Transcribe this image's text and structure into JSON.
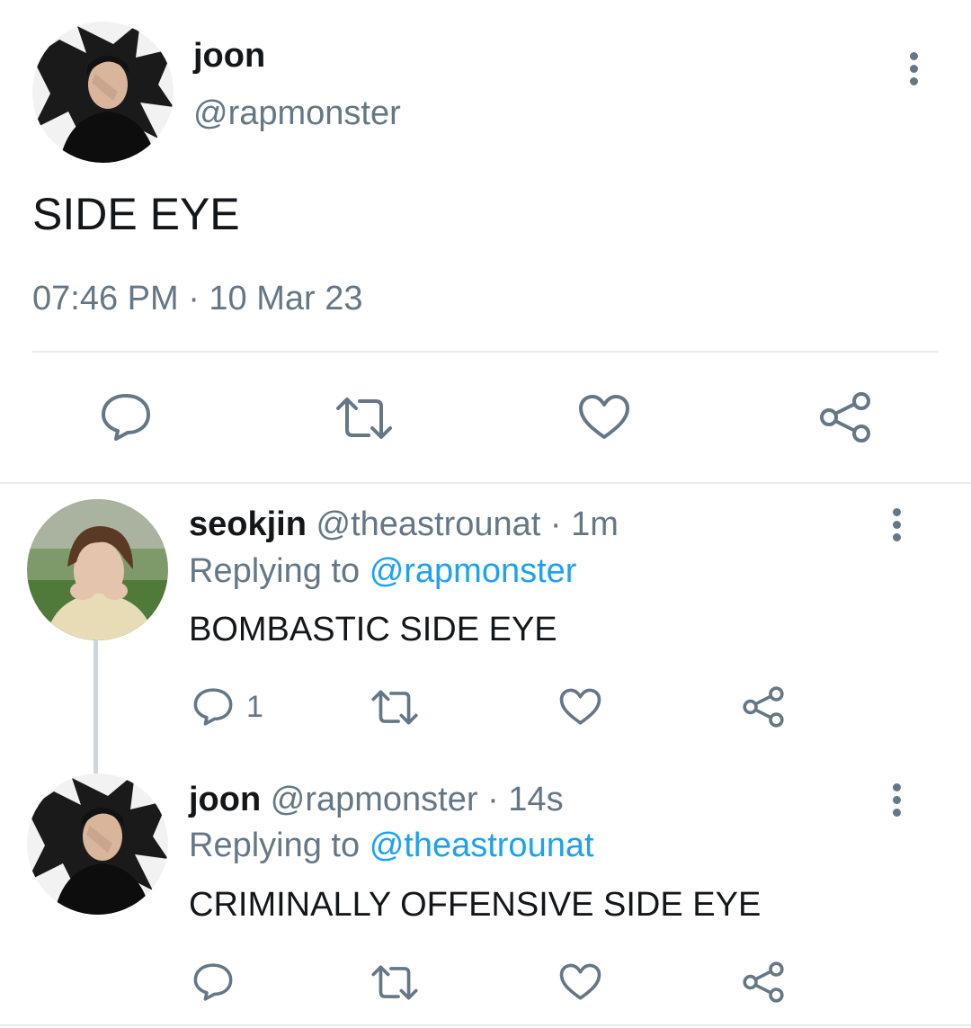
{
  "main_tweet": {
    "display_name": "joon",
    "handle": "@rapmonster",
    "text": "SIDE EYE",
    "timestamp": "07:46 PM · 10 Mar 23",
    "actions": [
      "reply-icon",
      "retweet-icon",
      "like-icon",
      "share-icon"
    ]
  },
  "replies": [
    {
      "display_name": "seokjin",
      "handle_time": "@theastrounat · 1m",
      "replying_prefix": "Replying to",
      "replying_to": "@rapmonster",
      "text": "BOMBASTIC SIDE EYE",
      "reply_count": "1"
    },
    {
      "display_name": "joon",
      "handle_time": "@rapmonster · 14s",
      "replying_prefix": "Replying to",
      "replying_to": "@theastrounat",
      "text": "CRIMINALLY OFFENSIVE SIDE EYE",
      "reply_count": ""
    }
  ],
  "colors": {
    "text": "#14171a",
    "muted": "#657786",
    "link": "#1da1f2",
    "divider": "#e6ecf0"
  }
}
